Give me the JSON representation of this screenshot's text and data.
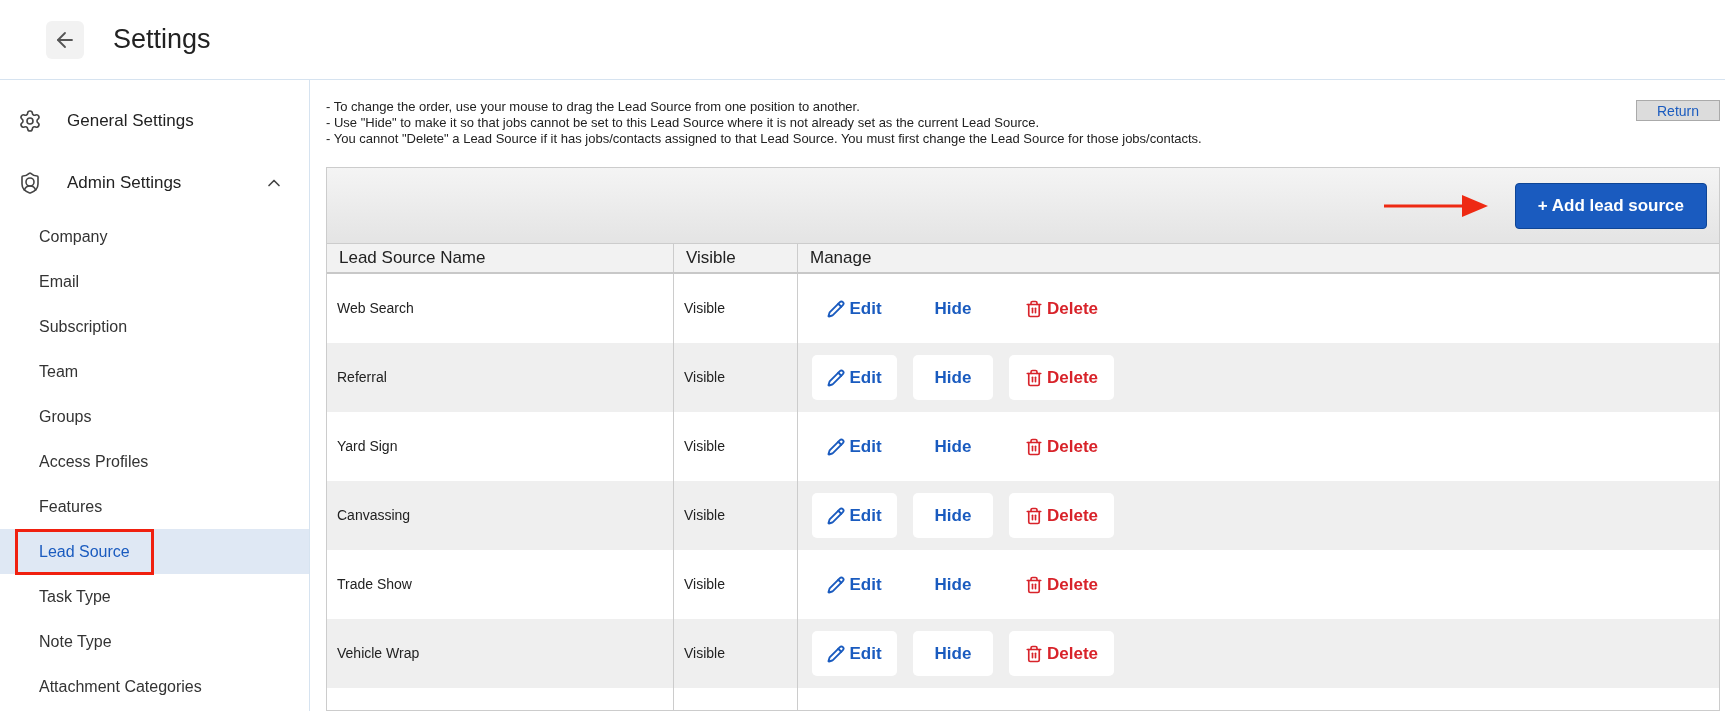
{
  "header": {
    "title": "Settings"
  },
  "sidebar": {
    "items": [
      {
        "label": "General Settings",
        "kind": "gear"
      },
      {
        "label": "Admin Settings",
        "kind": "shield",
        "expanded": true,
        "children": [
          {
            "label": "Company",
            "selected": false
          },
          {
            "label": "Email",
            "selected": false
          },
          {
            "label": "Subscription",
            "selected": false
          },
          {
            "label": "Team",
            "selected": false
          },
          {
            "label": "Groups",
            "selected": false
          },
          {
            "label": "Access Profiles",
            "selected": false
          },
          {
            "label": "Features",
            "selected": false
          },
          {
            "label": "Lead Source",
            "selected": true
          },
          {
            "label": "Task Type",
            "selected": false
          },
          {
            "label": "Note Type",
            "selected": false
          },
          {
            "label": "Attachment Categories",
            "selected": false
          }
        ]
      }
    ]
  },
  "notes": [
    "- To change the order, use your mouse to drag the Lead Source from one position to another.",
    "- Use \"Hide\" to make it so that jobs cannot be set to this Lead Source where it is not already set as the current Lead Source.",
    "- You cannot \"Delete\" a Lead Source if it has jobs/contacts assigned to that Lead Source. You must first change the Lead Source for those jobs/contacts."
  ],
  "return_button": "Return",
  "add_button": "+ Add lead source",
  "table": {
    "columns": [
      "Lead Source Name",
      "Visible",
      "Manage"
    ],
    "rows": [
      {
        "name": "Web Search",
        "visible": "Visible",
        "edit": "Edit",
        "hide": "Hide",
        "delete": "Delete"
      },
      {
        "name": "Referral",
        "visible": "Visible",
        "edit": "Edit",
        "hide": "Hide",
        "delete": "Delete"
      },
      {
        "name": "Yard Sign",
        "visible": "Visible",
        "edit": "Edit",
        "hide": "Hide",
        "delete": "Delete"
      },
      {
        "name": "Canvassing",
        "visible": "Visible",
        "edit": "Edit",
        "hide": "Hide",
        "delete": "Delete"
      },
      {
        "name": "Trade Show",
        "visible": "Visible",
        "edit": "Edit",
        "hide": "Hide",
        "delete": "Delete"
      },
      {
        "name": "Vehicle Wrap",
        "visible": "Visible",
        "edit": "Edit",
        "hide": "Hide",
        "delete": "Delete"
      }
    ]
  }
}
